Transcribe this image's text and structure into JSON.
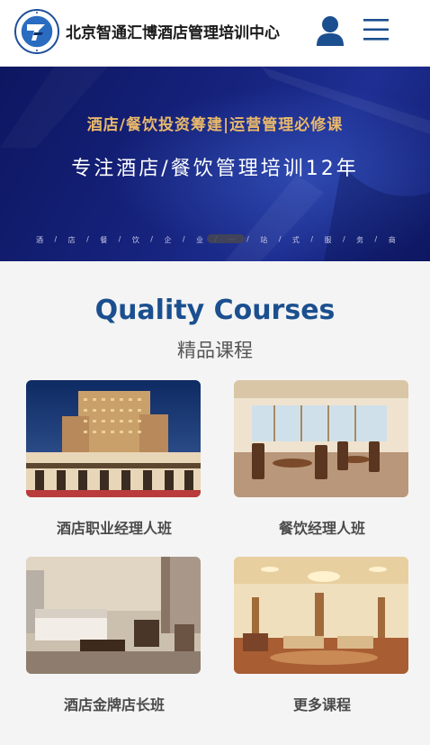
{
  "header": {
    "title": "北京智通汇博酒店管理培训中心",
    "logo_icon": "school-emblem-icon",
    "user_icon": "user-icon",
    "menu_icon": "hamburger-menu-icon"
  },
  "banner": {
    "tagline": "酒店/餐饮投资筹建|运营管理必修课",
    "headline": "专注酒店/餐饮管理培训12年",
    "strip": [
      "酒",
      "/",
      "店",
      "/",
      "餐",
      "/",
      "饮",
      "/",
      "企",
      "/",
      "业",
      "/",
      "一",
      "/",
      "站",
      "/",
      "式",
      "/",
      "服",
      "/",
      "务",
      "/",
      "商"
    ]
  },
  "courses": {
    "title": "Quality Courses",
    "subtitle": "精品课程",
    "items": [
      {
        "label": "酒店职业经理人班",
        "image": "hotel-exterior-photo"
      },
      {
        "label": "餐饮经理人班",
        "image": "restaurant-dining-photo"
      },
      {
        "label": "酒店金牌店长班",
        "image": "hotel-room-photo"
      },
      {
        "label": "更多课程",
        "image": "hotel-lobby-photo"
      }
    ]
  },
  "colors": {
    "accent": "#1b4f8f",
    "banner_bg": "#16237d",
    "banner_gold": "#e9b86a"
  }
}
